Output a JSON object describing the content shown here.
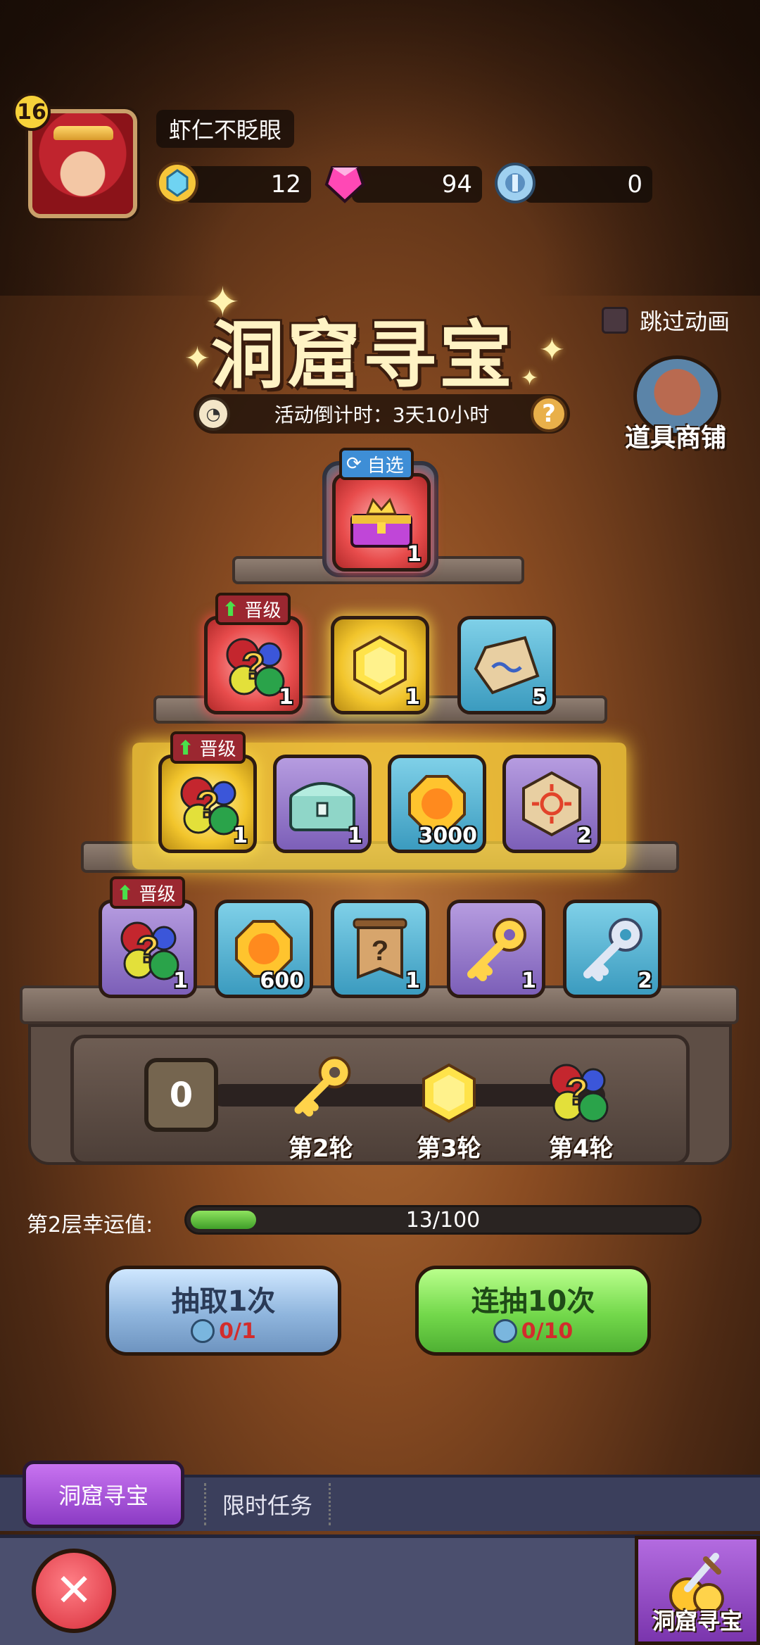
{
  "player": {
    "level": "16",
    "name": "虾仁不眨眼"
  },
  "resources": {
    "coins": "12",
    "gems": "94",
    "keys": "0"
  },
  "event": {
    "title": "洞窟寻宝",
    "countdown": "活动倒计时：3天10小时",
    "skip_label": "跳过动画",
    "shop_label": "道具商铺"
  },
  "tags": {
    "select": "自选",
    "upgrade": "晋级"
  },
  "pyramid": {
    "top": {
      "icon": "crown-chest-icon",
      "count": "1"
    },
    "row2": [
      {
        "icon": "mystery-gems-icon",
        "count": "1",
        "style": "red"
      },
      {
        "icon": "gold-gem-icon",
        "count": "1",
        "style": "gold"
      },
      {
        "icon": "rune-stone-icon",
        "count": "5",
        "style": "blue"
      }
    ],
    "row3": [
      {
        "icon": "mystery-gems-icon",
        "count": "1",
        "style": "gold"
      },
      {
        "icon": "teal-chest-icon",
        "count": "1",
        "style": "purple"
      },
      {
        "icon": "orange-coin-icon",
        "count": "3000",
        "style": "blue"
      },
      {
        "icon": "sun-rune-icon",
        "count": "2",
        "style": "purple"
      }
    ],
    "row4": [
      {
        "icon": "mystery-gems-icon",
        "count": "1",
        "style": "purple"
      },
      {
        "icon": "orange-coin-icon",
        "count": "600",
        "style": "blue"
      },
      {
        "icon": "mystery-scroll-icon",
        "count": "1",
        "style": "blue"
      },
      {
        "icon": "gold-key-icon",
        "count": "1",
        "style": "purple"
      },
      {
        "icon": "silver-key-icon",
        "count": "2",
        "style": "blue"
      }
    ]
  },
  "rounds": {
    "counter": "0",
    "stages": [
      {
        "icon": "gold-key-icon",
        "label": "第2轮"
      },
      {
        "icon": "gold-gem-icon",
        "label": "第3轮"
      },
      {
        "icon": "mystery-gems-icon",
        "label": "第4轮"
      }
    ]
  },
  "luck": {
    "label": "第2层幸运值:",
    "value_text": "13/100",
    "fraction": 0.13
  },
  "buttons": {
    "draw_one": {
      "title": "抽取1次",
      "cost": "0/1"
    },
    "draw_ten": {
      "title": "连抽10次",
      "cost": "0/10"
    }
  },
  "tabs": {
    "active": "洞窟寻宝",
    "second": "限时任务"
  },
  "footer": {
    "corner_label": "洞窟寻宝"
  },
  "colors": {
    "accent_gold": "#f2c52c",
    "luck_green": "#5fc03a",
    "cost_red": "#d22c2c"
  }
}
